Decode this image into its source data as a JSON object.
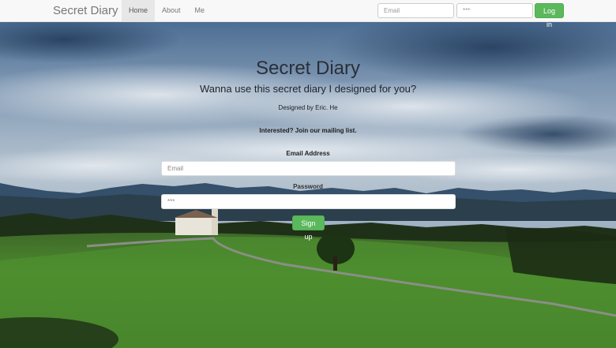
{
  "navbar": {
    "brand": "Secret Diary",
    "links": [
      {
        "label": "Home",
        "active": true
      },
      {
        "label": "About",
        "active": false
      },
      {
        "label": "Me",
        "active": false
      }
    ],
    "email_placeholder": "Email",
    "password_value": "***",
    "login_label": "Log in"
  },
  "hero": {
    "title": "Secret Diary",
    "subtitle": "Wanna use this secret diary I designed for you?",
    "designer": "Designed by Eric. He",
    "mailing": "Interested? Join our mailing list."
  },
  "signup": {
    "email_label": "Email Address",
    "email_placeholder": "Email",
    "password_label": "Password",
    "password_value": "***",
    "signup_label": "Sign up"
  },
  "colors": {
    "accent": "#5cb85c",
    "navbar_bg": "#f8f8f8"
  }
}
